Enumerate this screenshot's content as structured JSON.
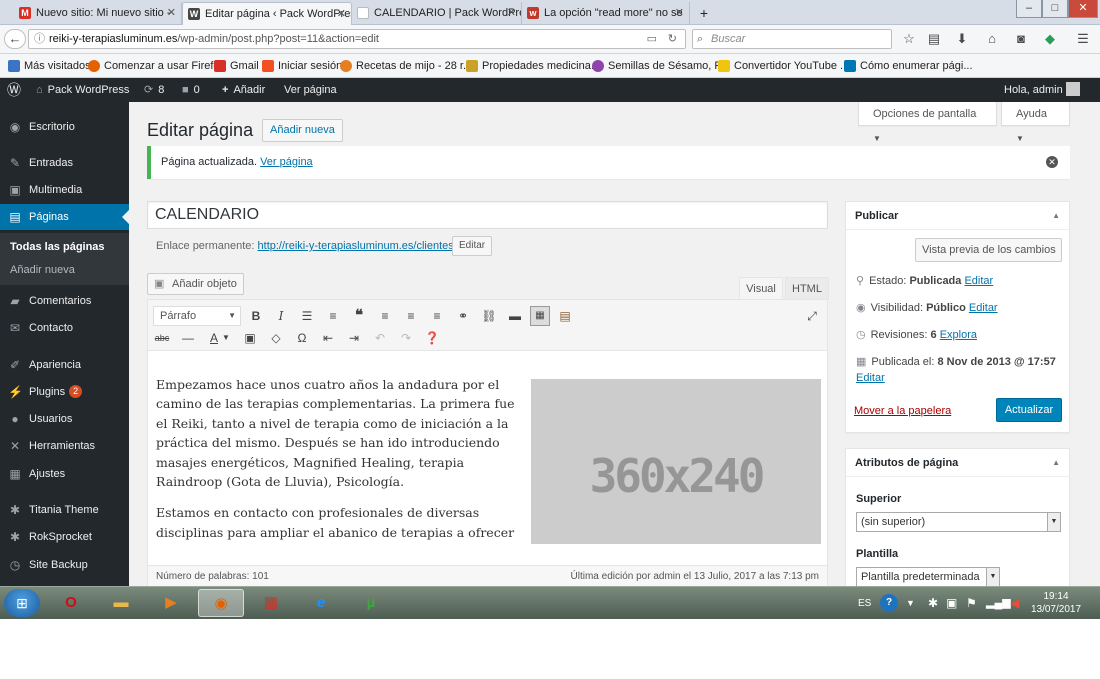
{
  "browser": {
    "tabs": [
      {
        "label": "Nuevo sitio: Mi nuevo sitio -",
        "icon": "gmail-icon",
        "color": "#d93025"
      },
      {
        "label": "Editar página ‹ Pack WordPress –",
        "icon": "wordpress-icon",
        "color": "#464646"
      },
      {
        "label": "CALENDARIO | Pack WordPress",
        "icon": "page-icon",
        "color": "#888888"
      },
      {
        "label": "La opción \"read more\" no se",
        "icon": "forum-icon",
        "color": "#c0392b"
      }
    ],
    "new_tab_label": "+",
    "window_controls": {
      "minimize": "–",
      "maximize": "□",
      "close": "✕"
    },
    "url_host": "reiki-y-terapiasluminum.es",
    "url_path": "/wp-admin/post.php?post=11&action=edit",
    "search_placeholder": "Buscar",
    "bookmarks": [
      {
        "label": "Más visitados",
        "color": "#3b73c5"
      },
      {
        "label": "Comenzar a usar Firefox",
        "color": "#e66000"
      },
      {
        "label": "Gmail",
        "color": "#d93025"
      },
      {
        "label": "Iniciar sesión",
        "color": "#f25022"
      },
      {
        "label": "Recetas de mijo - 28 r...",
        "color": "#e67e22"
      },
      {
        "label": "Propiedades medicina...",
        "color": "#c9a227"
      },
      {
        "label": "Semillas de Sésamo, P...",
        "color": "#8e44ad"
      },
      {
        "label": "Convertidor YouTube ...",
        "color": "#f1c40f"
      },
      {
        "label": "Cómo enumerar pági...",
        "color": "#0077b5"
      }
    ]
  },
  "adminbar": {
    "site_name": "Pack WordPress",
    "updates_count": "8",
    "comments_count": "0",
    "add_new": "Añadir",
    "view_page": "Ver página",
    "greeting": "Hola, admin"
  },
  "sidebar": {
    "items": [
      {
        "label": "Escritorio",
        "icon": "dashboard-icon",
        "glyph": "◉"
      },
      {
        "label": "Entradas",
        "icon": "pin-icon",
        "glyph": "✎"
      },
      {
        "label": "Multimedia",
        "icon": "media-icon",
        "glyph": "▣"
      },
      {
        "label": "Páginas",
        "icon": "pages-icon",
        "glyph": "▤"
      },
      {
        "label": "Comentarios",
        "icon": "comments-icon",
        "glyph": "▰"
      },
      {
        "label": "Contacto",
        "icon": "mail-icon",
        "glyph": "✉"
      },
      {
        "label": "Apariencia",
        "icon": "brush-icon",
        "glyph": "✐"
      },
      {
        "label": "Plugins",
        "icon": "plugin-icon",
        "glyph": "⚡",
        "badge": "2"
      },
      {
        "label": "Usuarios",
        "icon": "users-icon",
        "glyph": "●"
      },
      {
        "label": "Herramientas",
        "icon": "wrench-icon",
        "glyph": "✕"
      },
      {
        "label": "Ajustes",
        "icon": "settings-icon",
        "glyph": "▦"
      },
      {
        "label": "Titania Theme",
        "icon": "gear-icon",
        "glyph": "✱"
      },
      {
        "label": "RokSprocket",
        "icon": "gear-icon",
        "glyph": "✱"
      },
      {
        "label": "Site Backup",
        "icon": "backup-icon",
        "glyph": "◷"
      }
    ],
    "submenu": [
      "Todas las páginas",
      "Añadir nueva"
    ]
  },
  "screen": {
    "options": "Opciones de pantalla",
    "help": "Ayuda"
  },
  "page": {
    "title": "Editar página",
    "add_new": "Añadir nueva",
    "notice_text": "Página actualizada.",
    "notice_link": "Ver página",
    "post_title": "CALENDARIO",
    "permalink_label": "Enlace permanente:",
    "permalink_url": "http://reiki-y-terapiasluminum.es/clientes/",
    "permalink_edit": "Editar",
    "add_media": "Añadir objeto",
    "tab_visual": "Visual",
    "tab_html": "HTML",
    "format": "Párrafo",
    "paragraph1": "Empezamos hace unos cuatro años la andadura por el camino de las terapias complementarias. La primera fue el Reiki, tanto a nivel de terapia como de iniciación  a la práctica del mismo. Después se han ido introduciendo masajes energéticos,  Magnified Healing, terapia Raindroop (Gota de Lluvia), Psicología.",
    "paragraph2": "Estamos en contacto con profesionales de diversas disciplinas para ampliar el abanico de terapias a ofrecer a todas las personas que se acerquen a nuestros locales, así",
    "image_placeholder": "360x240",
    "word_count": "Número de palabras: 101",
    "last_edit": "Última edición por admin el 13 Julio, 2017 a las 7:13 pm"
  },
  "publish": {
    "heading": "Publicar",
    "preview": "Vista previa de los cambios",
    "status_label": "Estado:",
    "status_value": "Publicada",
    "status_edit": "Editar",
    "visibility_label": "Visibilidad:",
    "visibility_value": "Público",
    "visibility_edit": "Editar",
    "revisions_label": "Revisiones:",
    "revisions_value": "6",
    "revisions_link": "Explora",
    "published_label": "Publicada el:",
    "published_value": "8 Nov de 2013 @ 17:57",
    "published_edit": "Editar",
    "trash": "Mover a la papelera",
    "update": "Actualizar"
  },
  "attributes": {
    "heading": "Atributos de página",
    "parent_label": "Superior",
    "parent_value": "(sin superior)",
    "template_label": "Plantilla",
    "template_value": "Plantilla predeterminada"
  },
  "taskbar": {
    "lang": "ES",
    "time": "19:14",
    "date": "13/07/2017",
    "apps": [
      {
        "icon": "opera-icon",
        "glyph": "O",
        "color": "#cc0f16"
      },
      {
        "icon": "folder-icon",
        "glyph": "▬",
        "color": "#e8b84a"
      },
      {
        "icon": "media-player-icon",
        "glyph": "▶",
        "color": "#e67e22"
      },
      {
        "icon": "firefox-icon",
        "glyph": "◉",
        "color": "#e66000"
      },
      {
        "icon": "archive-icon",
        "glyph": "▦",
        "color": "#c0392b"
      },
      {
        "icon": "ie-icon",
        "glyph": "e",
        "color": "#1e90ff"
      },
      {
        "icon": "utorrent-icon",
        "glyph": "µ",
        "color": "#3aa83a"
      }
    ]
  }
}
